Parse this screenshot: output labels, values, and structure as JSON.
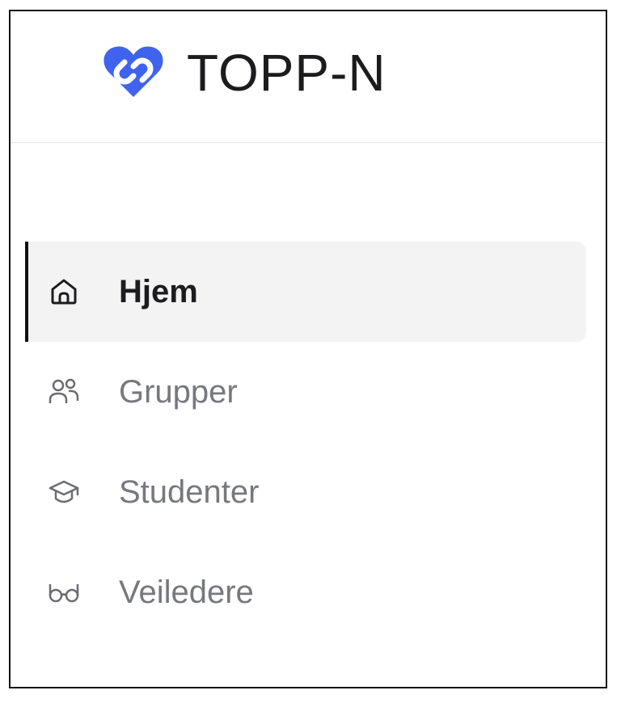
{
  "app": {
    "brand": "TOPP-N",
    "logo_icon": "heart-link-icon",
    "accent_color": "#3f63ec"
  },
  "sidebar": {
    "items": [
      {
        "label": "Hjem",
        "icon": "home-icon",
        "active": true
      },
      {
        "label": "Grupper",
        "icon": "users-icon",
        "active": false
      },
      {
        "label": "Studenter",
        "icon": "graduation-cap-icon",
        "active": false
      },
      {
        "label": "Veiledere",
        "icon": "glasses-icon",
        "active": false
      }
    ]
  }
}
